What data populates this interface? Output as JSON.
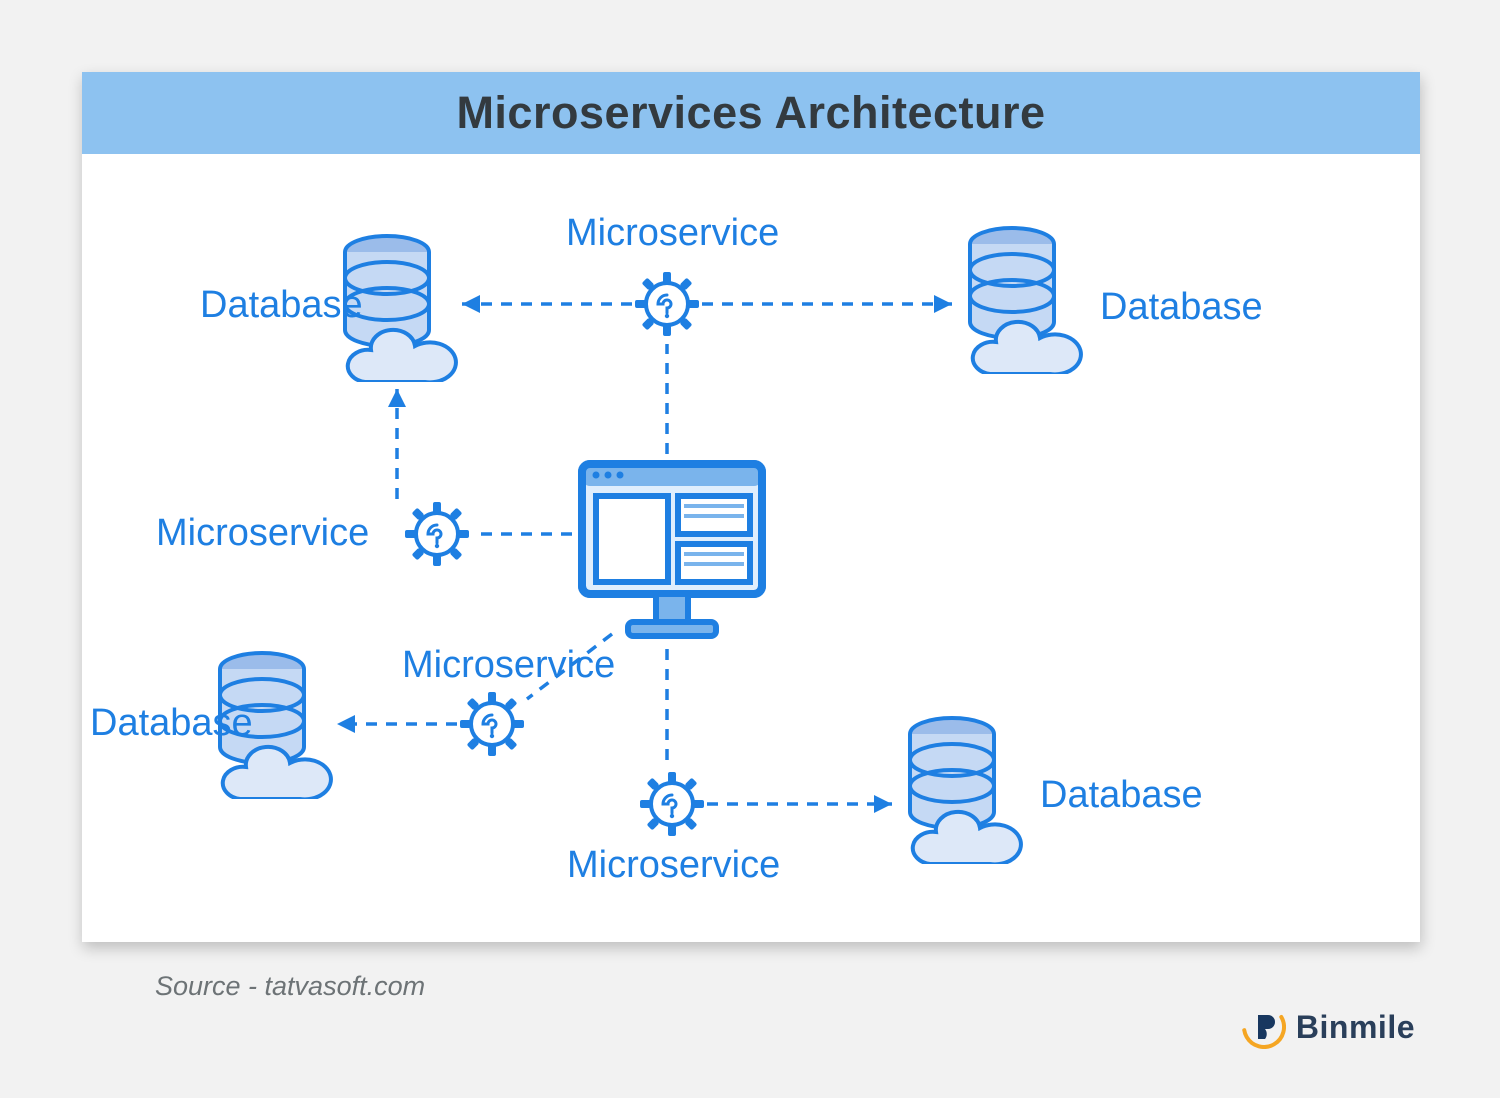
{
  "title": "Microservices Architecture",
  "labels": {
    "microservice_top": "Microservice",
    "microservice_left": "Microservice",
    "microservice_bl_label": "Microservice",
    "microservice_br_label": "Microservice",
    "database_tl": "Database",
    "database_tr": "Database",
    "database_bl": "Database",
    "database_br": "Database"
  },
  "source_text": "Source - tatvasoft.com",
  "brand": "Binmile",
  "colors": {
    "title_bg": "#8dc2f0",
    "accent": "#1e7fe2",
    "page_bg": "#f2f2f2"
  },
  "nodes": [
    {
      "id": "monitor",
      "type": "client"
    },
    {
      "id": "ms_top",
      "type": "microservice"
    },
    {
      "id": "ms_left",
      "type": "microservice"
    },
    {
      "id": "ms_bl",
      "type": "microservice"
    },
    {
      "id": "ms_br",
      "type": "microservice"
    },
    {
      "id": "db_tl",
      "type": "database"
    },
    {
      "id": "db_tr",
      "type": "database"
    },
    {
      "id": "db_bl",
      "type": "database"
    },
    {
      "id": "db_br",
      "type": "database"
    }
  ],
  "edges": [
    {
      "from": "monitor",
      "to": "ms_top"
    },
    {
      "from": "monitor",
      "to": "ms_left"
    },
    {
      "from": "monitor",
      "to": "ms_bl"
    },
    {
      "from": "monitor",
      "to": "ms_br"
    },
    {
      "from": "ms_top",
      "to": "db_tl"
    },
    {
      "from": "ms_top",
      "to": "db_tr"
    },
    {
      "from": "ms_left",
      "to": "db_tl"
    },
    {
      "from": "ms_bl",
      "to": "db_bl"
    },
    {
      "from": "ms_br",
      "to": "db_br"
    }
  ]
}
